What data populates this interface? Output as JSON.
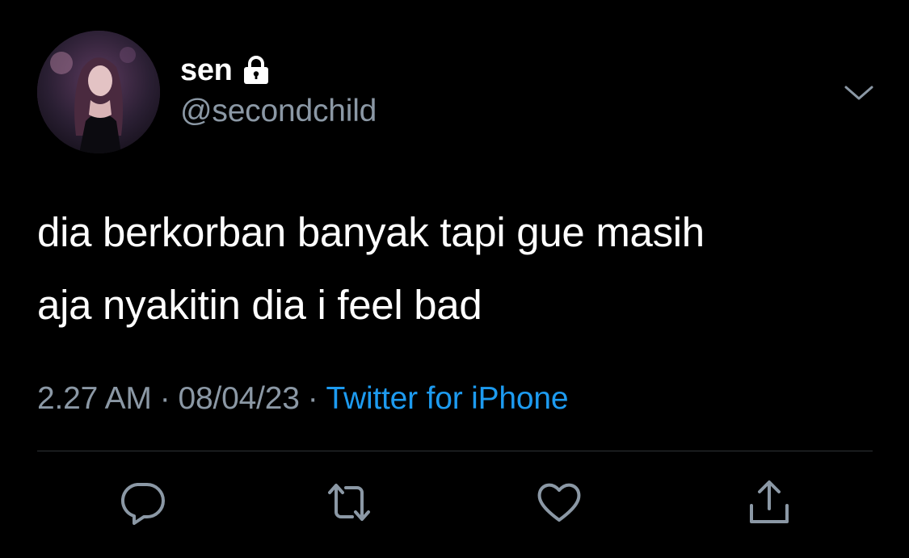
{
  "author": {
    "display_name": "sen",
    "handle": "@secondchild",
    "avatar": "profile-photo",
    "protected_icon": "lock-icon"
  },
  "tweet": {
    "text": "dia berkorban banyak tapi gue masih\naja nyakitin dia i feel bad",
    "time": "2.27 AM",
    "date": "08/04/23",
    "separator": "·",
    "source": "Twitter for iPhone"
  },
  "menu": {
    "icon": "chevron-down-icon"
  },
  "actions": [
    {
      "icon": "reply-icon"
    },
    {
      "icon": "retweet-icon"
    },
    {
      "icon": "like-icon"
    },
    {
      "icon": "share-icon"
    }
  ],
  "colors": {
    "background": "#000000",
    "primary_text": "#ffffff",
    "secondary_text": "#8b98a5",
    "link": "#1d9bf0",
    "divider": "#2f3336"
  }
}
